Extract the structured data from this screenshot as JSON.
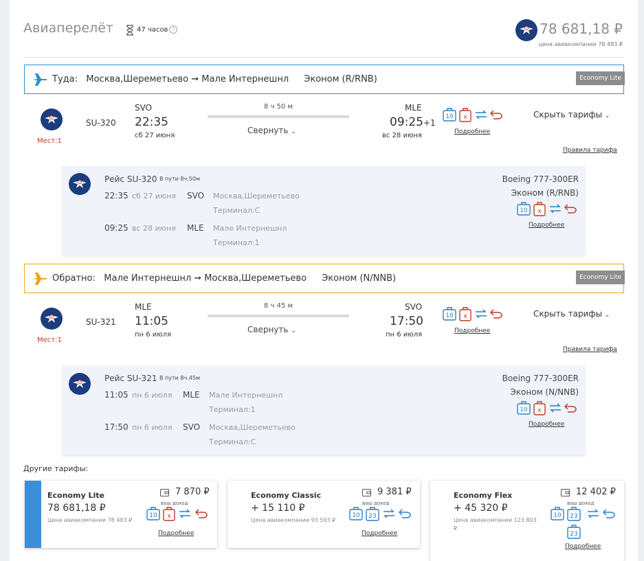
{
  "header": {
    "title": "Авиаперелёт",
    "duration": "47 часов",
    "price": "78 681,18 ₽",
    "airline_price": "цена авиакомпании 78 483 ₽"
  },
  "outbound": {
    "direction": "Туда:",
    "route": "Москва,Шереметьево ➞ Мале Интернешнл",
    "class": "Эконом (R/RNB)",
    "badge": "Economy Lite",
    "flight": "SU-320",
    "seats": "Мест:1",
    "dep_iata": "SVO",
    "dep_time": "22:35",
    "dep_date": "сб 27 июня",
    "duration": "8 ч 50 м",
    "collapse": "Свернуть",
    "arr_iata": "MLE",
    "arr_time": "09:25",
    "arr_plus": "+1",
    "arr_date": "вс 28 июня",
    "details": "Подробнее",
    "hide_fares": "Скрыть тарифы",
    "fare_rules": "Правила тарифа",
    "panel": {
      "flight": "Рейс SU-320",
      "in_way": "В пути 8ч.50м",
      "aircraft": "Boeing 777-300ER",
      "class": "Эконом (R/RNB)",
      "dep_time": "22:35",
      "dep_date": "сб 27 июня",
      "dep_iata": "SVO",
      "dep_airport": "Москва,Шереметьево",
      "dep_terminal": "Терминал:C",
      "arr_time": "09:25",
      "arr_date": "вс 28 июня",
      "arr_iata": "MLE",
      "arr_airport": "Мале Интернешнл",
      "arr_terminal": "Терминал:1",
      "details": "Подробнее"
    }
  },
  "inbound": {
    "direction": "Обратно:",
    "route": "Мале Интернешнл ➞ Москва,Шереметьево",
    "class": "Эконом (N/NNB)",
    "badge": "Economy Lite",
    "flight": "SU-321",
    "seats": "Мест:1",
    "dep_iata": "MLE",
    "dep_time": "11:05",
    "dep_date": "пн 6 июля",
    "duration": "8 ч 45 м",
    "collapse": "Свернуть",
    "arr_iata": "SVO",
    "arr_time": "17:50",
    "arr_date": "пн 6 июля",
    "details": "Подробнее",
    "hide_fares": "Скрыть тарифы",
    "fare_rules": "Правила тарифа",
    "panel": {
      "flight": "Рейс SU-321",
      "in_way": "В пути 8ч.45м",
      "aircraft": "Boeing 777-300ER",
      "class": "Эконом (N/NNB)",
      "dep_time": "11:05",
      "dep_date": "пн 6 июля",
      "dep_iata": "MLE",
      "dep_airport": "Мале Интернешнл",
      "dep_terminal": "Терминал:1",
      "arr_time": "17:50",
      "arr_date": "пн 6 июля",
      "arr_iata": "SVO",
      "arr_airport": "Москва,Шереметьево",
      "arr_terminal": "Терминал:C",
      "details": "Подробнее"
    }
  },
  "other_fares": {
    "label": "Другие тарифы:",
    "your_income": "ваш доход",
    "details": "Подробнее",
    "baggage_10": "10",
    "baggage_23": "23",
    "no_baggage": "x",
    "fares": [
      {
        "name": "Economy Lite",
        "price": "78 681,18 ₽",
        "airline": "Цена авиакомпании 78 483 ₽",
        "income": "7 870 ₽"
      },
      {
        "name": "Economy Classic",
        "price": "+ 15 110 ₽",
        "airline": "Цена авиакомпании 93 593 ₽",
        "income": "9 381 ₽"
      },
      {
        "name": "Economy Flex",
        "price": "+ 45 320 ₽",
        "airline": "Цена авиакомпании 123 803",
        "airline_currency": "₽",
        "income": "12 402 ₽"
      }
    ]
  },
  "colors": {
    "outbound_border": "#2d8fd1",
    "inbound_border": "#f0a21a",
    "logo_bg": "#1b3d7d",
    "baggage_blue": "#2a7fc4",
    "baggage_red": "#c0392b"
  }
}
